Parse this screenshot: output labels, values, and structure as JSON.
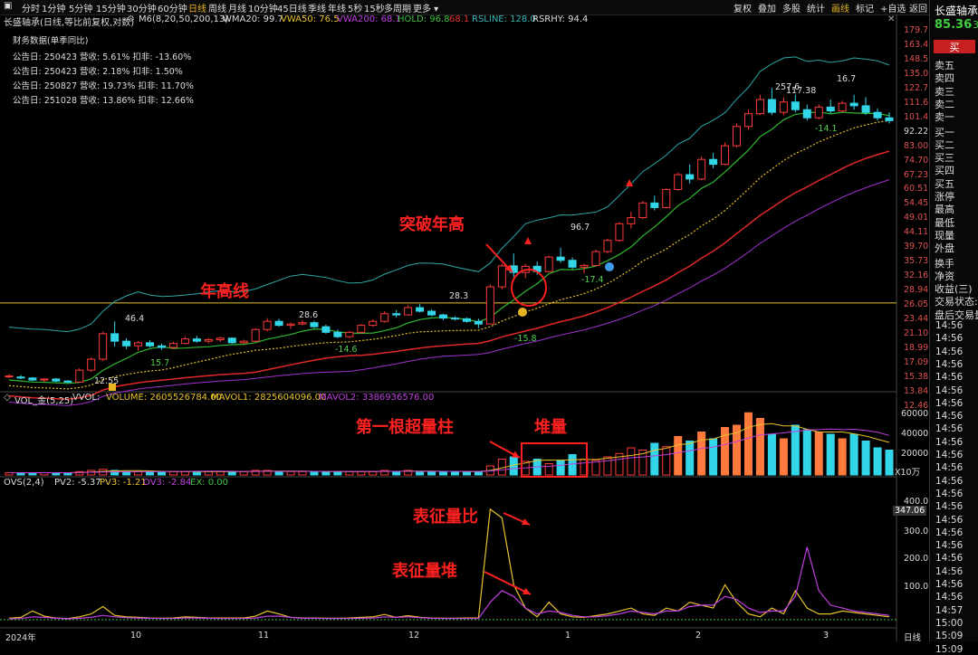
{
  "toolbar": {
    "title": "长盛轴承",
    "periods": [
      "分时",
      "1分钟",
      "5分钟",
      "15分钟",
      "30分钟",
      "60分钟",
      "日线",
      "周线",
      "月线",
      "10分钟",
      "45日线",
      "季线",
      "年线",
      "5秒",
      "15秒",
      "多周期",
      "更多"
    ],
    "active_period": "日线",
    "right_tools": [
      "复权",
      "叠加",
      "多股",
      "统计",
      "画线",
      "标记",
      "+自选",
      "返回"
    ],
    "active_tool": "画线"
  },
  "main_header": {
    "name": "长盛轴承(日线,等比前复权,对数)",
    "m6": "M6(8,20,50,200,13)",
    "wma20": "WMA20: 99.7",
    "vwa50": "VWA50: 76.5",
    "vwa200": "VWA200: 68.1",
    "hold": "HOLD: 96.8",
    "hold2": "68.1",
    "rsline": "RSLINE: 128.0",
    "rshy": "RSRHY: 94.4"
  },
  "financials": {
    "title": "财务数据(单季同比)",
    "rows": [
      "公告日: 250423   营收: 5.61%    扣非: -13.60%",
      "公告日: 250423   营收: 2.18%    扣非: 1.50%",
      "公告日: 250827   营收: 19.73%   扣非: 11.70%",
      "公告日: 251028   营收: 13.86%   扣非: 12.66%"
    ]
  },
  "price_axis": [
    "179.7",
    "163.4",
    "148.5",
    "135.0",
    "122.7",
    "111.6",
    "101.4",
    "92.22",
    "83.00",
    "74.70",
    "67.23",
    "60.51",
    "54.45",
    "49.01",
    "44.11",
    "39.70",
    "35.73",
    "32.16",
    "28.94",
    "26.05",
    "23.44",
    "21.10",
    "18.99",
    "17.09",
    "15.38",
    "13.84",
    "12.46"
  ],
  "annotations": {
    "breakout": "突破年高",
    "year_high_line": "年高线",
    "first_volume_bar": "第一根超量柱",
    "stacked_volume": "堆量",
    "vol_ratio": "表征量比",
    "vol_stack": "表征量堆"
  },
  "price_labels": {
    "p46": "46.4",
    "p12": "12.55",
    "p15": "15.7",
    "p28a": "28.6",
    "p14": "-14.6",
    "p28b": "28.3",
    "p158": "-15.8",
    "p96": "96.7",
    "p174": "-17.4",
    "p257": "257.6",
    "p117": "117.38",
    "p16": "16.7",
    "p141": "-14.1"
  },
  "volume_header": {
    "name": "VOL_金(5,25)",
    "vvol": "VVOL:",
    "volume": "VOLUME: 2605526784.00",
    "mavol1": "MAVOL1: 2825604096.00",
    "mavol2": "MAVOL2: 3386936576.00"
  },
  "volume_axis": [
    "60000",
    "40000",
    "20000",
    "X10万"
  ],
  "ovs_header": {
    "name": "OVS(2,4)",
    "pv2": "PV2: -5.37",
    "pv3": "PV3: -1.21",
    "ov3": "OV3: -2.84",
    "ex": "EX: 0.00"
  },
  "ovs_axis": [
    "400.0",
    "347.06",
    "300.0",
    "200.0",
    "100.0"
  ],
  "time_axis": {
    "start": "2024年",
    "months": [
      "10",
      "11",
      "12",
      "1",
      "2",
      "3"
    ],
    "right": "日线"
  },
  "sidebar": {
    "title": "长盛轴承",
    "price": "85.36",
    "change": "-3",
    "buy_button": "买",
    "sell_levels": [
      "卖五",
      "卖四",
      "卖三",
      "卖二",
      "卖一"
    ],
    "buy_levels": [
      "买一",
      "买二",
      "买三",
      "买四",
      "买五"
    ],
    "stats": [
      "涨停",
      "最高",
      "最低",
      "现量",
      "外盘"
    ],
    "stats2": [
      "换手",
      "净资",
      "收益(三)"
    ],
    "trade_state": "交易状态:",
    "after_hours": "盘后交易量",
    "times": [
      "14:56",
      "14:56",
      "14:56",
      "14:56",
      "14:56",
      "14:56",
      "14:56",
      "14:56",
      "14:56",
      "14:56",
      "14:56",
      "14:56",
      "14:56",
      "14:56",
      "14:56",
      "14:56",
      "14:56",
      "14:56",
      "14:56",
      "14:56",
      "14:56",
      "14:56",
      "14:57",
      "15:00",
      "15:09",
      "15:09"
    ]
  },
  "chart_data": {
    "type": "candlestick",
    "note_scale": "log",
    "year_high_line": 23.0,
    "ohlc": [
      [
        13.2,
        13.4,
        13.0,
        13.2
      ],
      [
        13.1,
        13.3,
        12.9,
        13.0
      ],
      [
        13.0,
        13.1,
        12.7,
        12.8
      ],
      [
        12.8,
        13.0,
        12.6,
        12.9
      ],
      [
        12.9,
        13.0,
        12.6,
        12.7
      ],
      [
        12.7,
        12.8,
        12.5,
        12.6
      ],
      [
        12.6,
        14.0,
        12.6,
        13.8
      ],
      [
        13.8,
        15.2,
        13.6,
        15.0
      ],
      [
        15.0,
        18.5,
        14.8,
        18.2
      ],
      [
        18.2,
        20.0,
        16.5,
        17.2
      ],
      [
        17.2,
        17.6,
        16.2,
        16.6
      ],
      [
        16.6,
        17.2,
        16.0,
        17.0
      ],
      [
        17.0,
        17.3,
        16.4,
        16.6
      ],
      [
        16.6,
        16.9,
        16.1,
        16.4
      ],
      [
        16.4,
        17.1,
        16.2,
        16.9
      ],
      [
        16.9,
        17.8,
        16.8,
        17.5
      ],
      [
        17.5,
        17.9,
        17.0,
        17.2
      ],
      [
        17.2,
        17.6,
        16.9,
        17.4
      ],
      [
        17.4,
        17.8,
        17.1,
        17.6
      ],
      [
        17.6,
        17.7,
        16.9,
        17.0
      ],
      [
        17.0,
        17.4,
        16.8,
        17.2
      ],
      [
        17.2,
        19.0,
        17.1,
        18.8
      ],
      [
        18.8,
        20.5,
        18.5,
        20.0
      ],
      [
        20.0,
        20.4,
        19.2,
        19.4
      ],
      [
        19.4,
        19.8,
        18.9,
        19.6
      ],
      [
        19.6,
        20.2,
        19.4,
        19.8
      ],
      [
        19.8,
        20.1,
        19.0,
        19.2
      ],
      [
        19.2,
        19.5,
        18.2,
        18.4
      ],
      [
        18.4,
        18.8,
        17.6,
        17.8
      ],
      [
        17.8,
        18.6,
        17.6,
        18.4
      ],
      [
        18.4,
        19.6,
        18.2,
        19.4
      ],
      [
        19.4,
        20.3,
        19.2,
        20.0
      ],
      [
        20.0,
        21.6,
        19.8,
        21.2
      ],
      [
        21.2,
        21.8,
        20.6,
        21.0
      ],
      [
        21.0,
        22.6,
        20.9,
        22.2
      ],
      [
        22.2,
        22.8,
        21.4,
        21.6
      ],
      [
        21.6,
        21.9,
        20.8,
        21.0
      ],
      [
        21.0,
        21.2,
        20.2,
        20.5
      ],
      [
        20.5,
        20.8,
        20.1,
        20.4
      ],
      [
        20.4,
        20.6,
        19.8,
        20.0
      ],
      [
        20.0,
        20.4,
        19.0,
        19.6
      ],
      [
        19.6,
        26.5,
        19.6,
        26.0
      ],
      [
        26.0,
        31.0,
        25.5,
        30.5
      ],
      [
        30.5,
        33.5,
        28.0,
        29.0
      ],
      [
        29.0,
        31.0,
        27.8,
        30.4
      ],
      [
        30.4,
        31.5,
        28.5,
        29.2
      ],
      [
        29.2,
        33.0,
        29.0,
        32.6
      ],
      [
        32.6,
        35.0,
        31.2,
        31.8
      ],
      [
        31.8,
        32.5,
        29.8,
        30.2
      ],
      [
        30.2,
        31.0,
        28.8,
        30.6
      ],
      [
        30.6,
        34.5,
        30.4,
        34.0
      ],
      [
        34.0,
        37.5,
        33.6,
        37.0
      ],
      [
        37.0,
        42.5,
        36.6,
        42.0
      ],
      [
        42.0,
        46.0,
        40.5,
        44.0
      ],
      [
        44.0,
        50.0,
        43.5,
        49.2
      ],
      [
        49.2,
        52.0,
        46.5,
        47.5
      ],
      [
        47.5,
        55.0,
        47.2,
        54.5
      ],
      [
        54.5,
        62.0,
        54.0,
        61.0
      ],
      [
        61.0,
        66.0,
        57.0,
        59.0
      ],
      [
        59.0,
        70.0,
        58.5,
        68.5
      ],
      [
        68.5,
        72.0,
        64.0,
        66.0
      ],
      [
        66.0,
        78.0,
        65.5,
        76.0
      ],
      [
        76.0,
        90.0,
        75.0,
        88.0
      ],
      [
        88.0,
        100.0,
        86.0,
        97.0
      ],
      [
        97.0,
        112.0,
        96.0,
        108.0
      ],
      [
        108.0,
        118.0,
        96.0,
        98.0
      ],
      [
        98.0,
        110.0,
        96.0,
        106.0
      ],
      [
        106.0,
        112.0,
        98.0,
        100.0
      ],
      [
        100.0,
        104.0,
        92.0,
        94.0
      ],
      [
        94.0,
        104.0,
        93.0,
        102.0
      ],
      [
        102.0,
        108.0,
        97.0,
        99.0
      ],
      [
        99.0,
        107.0,
        98.0,
        105.0
      ],
      [
        105.0,
        112.0,
        100.0,
        103.0
      ],
      [
        103.0,
        110.0,
        96.0,
        98.0
      ],
      [
        98.0,
        101.0,
        92.0,
        94.0
      ],
      [
        94.0,
        98.0,
        90.0,
        92.0
      ]
    ],
    "volume": [
      2,
      2,
      2,
      2,
      2,
      2,
      3,
      4,
      5,
      4,
      3,
      3,
      3,
      3,
      3,
      3,
      3,
      3,
      3,
      3,
      3,
      4,
      4,
      3,
      3,
      3,
      3,
      3,
      3,
      3,
      3,
      3,
      4,
      3,
      4,
      3,
      3,
      3,
      3,
      3,
      3,
      8,
      14,
      16,
      12,
      14,
      10,
      13,
      18,
      14,
      13,
      16,
      19,
      24,
      22,
      28,
      25,
      34,
      30,
      38,
      32,
      42,
      44,
      55,
      50,
      36,
      32,
      44,
      40,
      38,
      36,
      32,
      36,
      30,
      24,
      22
    ],
    "ovs": [
      5,
      8,
      30,
      12,
      6,
      4,
      10,
      20,
      45,
      15,
      10,
      8,
      6,
      5,
      6,
      10,
      8,
      6,
      6,
      6,
      6,
      12,
      30,
      20,
      8,
      6,
      6,
      5,
      5,
      6,
      8,
      10,
      18,
      8,
      14,
      8,
      6,
      5,
      5,
      6,
      6,
      380,
      350,
      120,
      40,
      10,
      60,
      20,
      10,
      8,
      14,
      20,
      30,
      40,
      20,
      15,
      40,
      30,
      60,
      50,
      40,
      120,
      60,
      20,
      10,
      40,
      20,
      100,
      40,
      20,
      20,
      30,
      25,
      20,
      15,
      10
    ],
    "ov3": [
      3,
      4,
      10,
      8,
      5,
      3,
      5,
      8,
      15,
      10,
      7,
      6,
      5,
      4,
      4,
      6,
      6,
      5,
      4,
      4,
      4,
      6,
      12,
      12,
      8,
      5,
      5,
      4,
      4,
      4,
      5,
      6,
      10,
      8,
      10,
      7,
      5,
      4,
      4,
      4,
      4,
      60,
      100,
      80,
      40,
      20,
      30,
      25,
      15,
      10,
      10,
      14,
      20,
      30,
      25,
      20,
      30,
      30,
      45,
      50,
      50,
      80,
      70,
      40,
      25,
      30,
      30,
      80,
      250,
      100,
      50,
      40,
      30,
      25,
      20,
      15
    ]
  }
}
